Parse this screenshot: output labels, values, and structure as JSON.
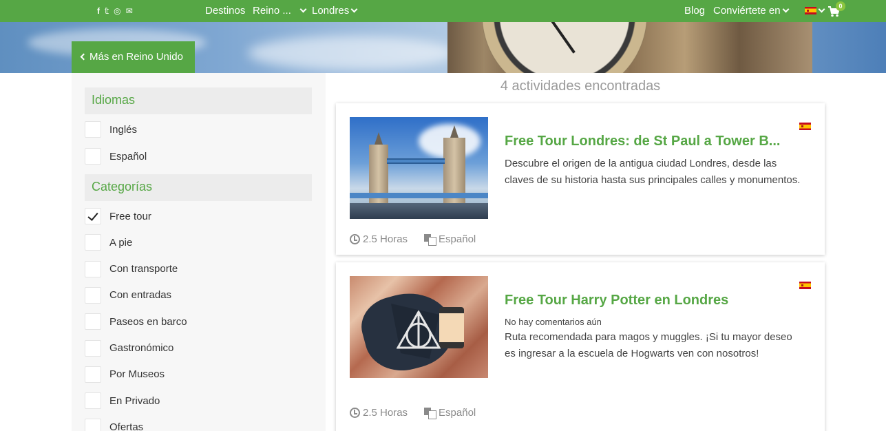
{
  "topnav": {
    "social_icons": [
      "facebook-icon",
      "twitter-icon",
      "instagram-icon",
      "envelope-icon"
    ],
    "social_glyphs": [
      "f",
      "𝕥",
      "◎",
      "✉"
    ],
    "destinos": "Destinos",
    "reino": "Reino ...",
    "londres": "Londres",
    "blog": "Blog",
    "convierte": "Conviértete en",
    "cart_count": "0"
  },
  "hero": {
    "back_label": "Más en Reino Unido"
  },
  "sidebar": {
    "idiomas_title": "Idiomas",
    "idiomas": [
      {
        "label": "Inglés",
        "checked": false
      },
      {
        "label": "Español",
        "checked": false
      }
    ],
    "categorias_title": "Categorías",
    "categorias": [
      {
        "label": "Free tour",
        "checked": true
      },
      {
        "label": "A pie",
        "checked": false
      },
      {
        "label": "Con transporte",
        "checked": false
      },
      {
        "label": "Con entradas",
        "checked": false
      },
      {
        "label": "Paseos en barco",
        "checked": false
      },
      {
        "label": "Gastronómico",
        "checked": false
      },
      {
        "label": "Por Museos",
        "checked": false
      },
      {
        "label": "En Privado",
        "checked": false
      },
      {
        "label": "Ofertas",
        "checked": false
      }
    ]
  },
  "main": {
    "results_count": "4 actividades encontradas",
    "cards": [
      {
        "title": "Free Tour Londres: de St Paul a Tower B...",
        "review": "",
        "description": "Descubre el origen de la antigua ciudad Londres, desde las claves de su historia hasta sus principales calles y monumentos.",
        "duration": "2.5 Horas",
        "language": "Español"
      },
      {
        "title": "Free Tour Harry Potter en Londres",
        "review": "No hay comentarios aún",
        "description": "Ruta recomendada para magos y muggles. ¡Si tu mayor deseo es ingresar a la escuela de Hogwarts ven con nosotros!",
        "duration": "2.5 Horas",
        "language": "Español"
      }
    ]
  },
  "colors": {
    "brand_green": "#56a745",
    "badge_green": "#8cc63f"
  }
}
